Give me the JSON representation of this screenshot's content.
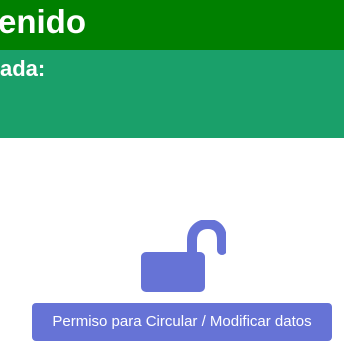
{
  "header": {
    "title": "enido"
  },
  "subheader": {
    "label": "ada:"
  },
  "lock": {
    "icon": "unlock-icon",
    "color": "#6673d6"
  },
  "actions": {
    "permiso_button_label": "Permiso para Circular / Modificar datos"
  },
  "colors": {
    "header_bg": "#008000",
    "subheader_bg": "#1aa06a",
    "accent": "#6673d6"
  }
}
